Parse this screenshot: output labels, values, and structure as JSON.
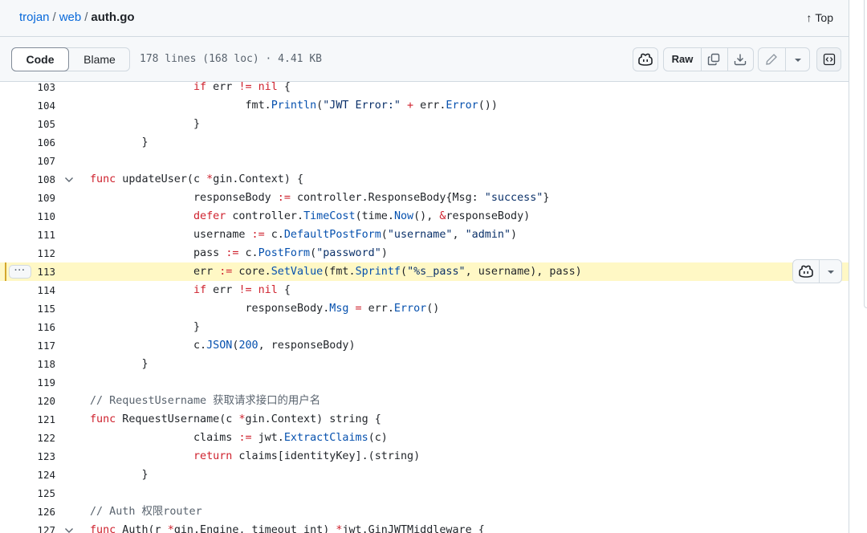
{
  "breadcrumb": {
    "repo": "trojan",
    "sep": "/",
    "dir": "web",
    "file": "auth.go"
  },
  "top_link": {
    "arrow": "↑",
    "label": "Top"
  },
  "toolbar": {
    "code_tab": "Code",
    "blame_tab": "Blame",
    "file_info": "178 lines (168 loc) · 4.41 KB",
    "raw_label": "Raw"
  },
  "icons": {
    "copilot": "copilot-icon",
    "copy": "copy-icon",
    "download": "download-icon",
    "edit": "pencil-icon",
    "dropdown": "triangle-down-icon",
    "symbols": "code-square-icon",
    "fold": "chevron-down-icon",
    "line_actions": "kebab-horizontal-icon"
  },
  "colors": {
    "keyword": "#cf222e",
    "function": "#0550ae",
    "string": "#0a3069",
    "comment": "#59636e",
    "highlight": "#fff8c5",
    "link": "#0969da"
  },
  "line_actions_label": "···",
  "highlighted_line": 113,
  "lines": [
    {
      "n": "103",
      "segs": [
        [
          "\t\t",
          ""
        ],
        [
          "if",
          "kw"
        ],
        [
          " err ",
          ""
        ],
        [
          "!=",
          "kw"
        ],
        [
          " ",
          ""
        ],
        [
          "nil",
          "kw"
        ],
        [
          " {",
          ""
        ]
      ]
    },
    {
      "n": "104",
      "segs": [
        [
          "\t\t\tfmt.",
          ""
        ],
        [
          "Println",
          "fn"
        ],
        [
          "(",
          ""
        ],
        [
          "\"JWT Error:\"",
          "str"
        ],
        [
          " ",
          ""
        ],
        [
          "+",
          "kw"
        ],
        [
          " err.",
          ""
        ],
        [
          "Error",
          "fn"
        ],
        [
          "())",
          ""
        ]
      ]
    },
    {
      "n": "105",
      "segs": [
        [
          "\t\t}",
          ""
        ]
      ]
    },
    {
      "n": "106",
      "segs": [
        [
          "\t}",
          ""
        ]
      ]
    },
    {
      "n": "107",
      "segs": [
        [
          "",
          ""
        ]
      ]
    },
    {
      "n": "108",
      "fold": true,
      "segs": [
        [
          "func",
          "kw"
        ],
        [
          " updateUser(c ",
          ""
        ],
        [
          "*",
          "kw"
        ],
        [
          "gin.Context) {",
          ""
        ]
      ]
    },
    {
      "n": "109",
      "segs": [
        [
          "\t\tresponseBody ",
          ""
        ],
        [
          ":=",
          "kw"
        ],
        [
          " controller.ResponseBody{Msg: ",
          ""
        ],
        [
          "\"success\"",
          "str"
        ],
        [
          "}",
          ""
        ]
      ]
    },
    {
      "n": "110",
      "segs": [
        [
          "\t\t",
          ""
        ],
        [
          "defer",
          "kw"
        ],
        [
          " controller.",
          ""
        ],
        [
          "TimeCost",
          "fn"
        ],
        [
          "(time.",
          ""
        ],
        [
          "Now",
          "fn"
        ],
        [
          "(), ",
          ""
        ],
        [
          "&",
          "kw"
        ],
        [
          "responseBody)",
          ""
        ]
      ]
    },
    {
      "n": "111",
      "segs": [
        [
          "\t\tusername ",
          ""
        ],
        [
          ":=",
          "kw"
        ],
        [
          " c.",
          ""
        ],
        [
          "DefaultPostForm",
          "fn"
        ],
        [
          "(",
          ""
        ],
        [
          "\"username\"",
          "str"
        ],
        [
          ", ",
          ""
        ],
        [
          "\"admin\"",
          "str"
        ],
        [
          ")",
          ""
        ]
      ]
    },
    {
      "n": "112",
      "segs": [
        [
          "\t\tpass ",
          ""
        ],
        [
          ":=",
          "kw"
        ],
        [
          " c.",
          ""
        ],
        [
          "PostForm",
          "fn"
        ],
        [
          "(",
          ""
        ],
        [
          "\"password\"",
          "str"
        ],
        [
          ")",
          ""
        ]
      ]
    },
    {
      "n": "113",
      "segs": [
        [
          "\t\terr ",
          ""
        ],
        [
          ":=",
          "kw"
        ],
        [
          " core.",
          ""
        ],
        [
          "SetValue",
          "fn"
        ],
        [
          "(fmt.",
          ""
        ],
        [
          "Sprintf",
          "fn"
        ],
        [
          "(",
          ""
        ],
        [
          "\"%s_pass\"",
          "str"
        ],
        [
          ", username), pass)",
          ""
        ]
      ]
    },
    {
      "n": "114",
      "segs": [
        [
          "\t\t",
          ""
        ],
        [
          "if",
          "kw"
        ],
        [
          " err ",
          ""
        ],
        [
          "!=",
          "kw"
        ],
        [
          " ",
          ""
        ],
        [
          "nil",
          "kw"
        ],
        [
          " {",
          ""
        ]
      ]
    },
    {
      "n": "115",
      "segs": [
        [
          "\t\t\tresponseBody.",
          ""
        ],
        [
          "Msg",
          "fn"
        ],
        [
          " ",
          ""
        ],
        [
          "=",
          "kw"
        ],
        [
          " err.",
          ""
        ],
        [
          "Error",
          "fn"
        ],
        [
          "()",
          ""
        ]
      ]
    },
    {
      "n": "116",
      "segs": [
        [
          "\t\t}",
          ""
        ]
      ]
    },
    {
      "n": "117",
      "segs": [
        [
          "\t\tc.",
          ""
        ],
        [
          "JSON",
          "fn"
        ],
        [
          "(",
          ""
        ],
        [
          "200",
          "fn"
        ],
        [
          ", responseBody)",
          ""
        ]
      ]
    },
    {
      "n": "118",
      "segs": [
        [
          "\t}",
          ""
        ]
      ]
    },
    {
      "n": "119",
      "segs": [
        [
          "",
          ""
        ]
      ]
    },
    {
      "n": "120",
      "segs": [
        [
          "// RequestUsername 获取请求接口的用户名",
          "cm"
        ]
      ]
    },
    {
      "n": "121",
      "segs": [
        [
          "func",
          "kw"
        ],
        [
          " RequestUsername(c ",
          ""
        ],
        [
          "*",
          "kw"
        ],
        [
          "gin.Context) string {",
          ""
        ]
      ]
    },
    {
      "n": "122",
      "segs": [
        [
          "\t\tclaims ",
          ""
        ],
        [
          ":=",
          "kw"
        ],
        [
          " jwt.",
          ""
        ],
        [
          "ExtractClaims",
          "fn"
        ],
        [
          "(c)",
          ""
        ]
      ]
    },
    {
      "n": "123",
      "segs": [
        [
          "\t\t",
          ""
        ],
        [
          "return",
          "kw"
        ],
        [
          " claims[identityKey].(string)",
          ""
        ]
      ]
    },
    {
      "n": "124",
      "segs": [
        [
          "\t}",
          ""
        ]
      ]
    },
    {
      "n": "125",
      "segs": [
        [
          "",
          ""
        ]
      ]
    },
    {
      "n": "126",
      "segs": [
        [
          "// Auth 权限router",
          "cm"
        ]
      ]
    },
    {
      "n": "127",
      "fold": true,
      "segs": [
        [
          "func",
          "kw"
        ],
        [
          " Auth(r ",
          ""
        ],
        [
          "*",
          "kw"
        ],
        [
          "gin.Engine, timeout int) ",
          ""
        ],
        [
          "*",
          "kw"
        ],
        [
          "jwt.GinJWTMiddleware {",
          ""
        ]
      ]
    }
  ]
}
